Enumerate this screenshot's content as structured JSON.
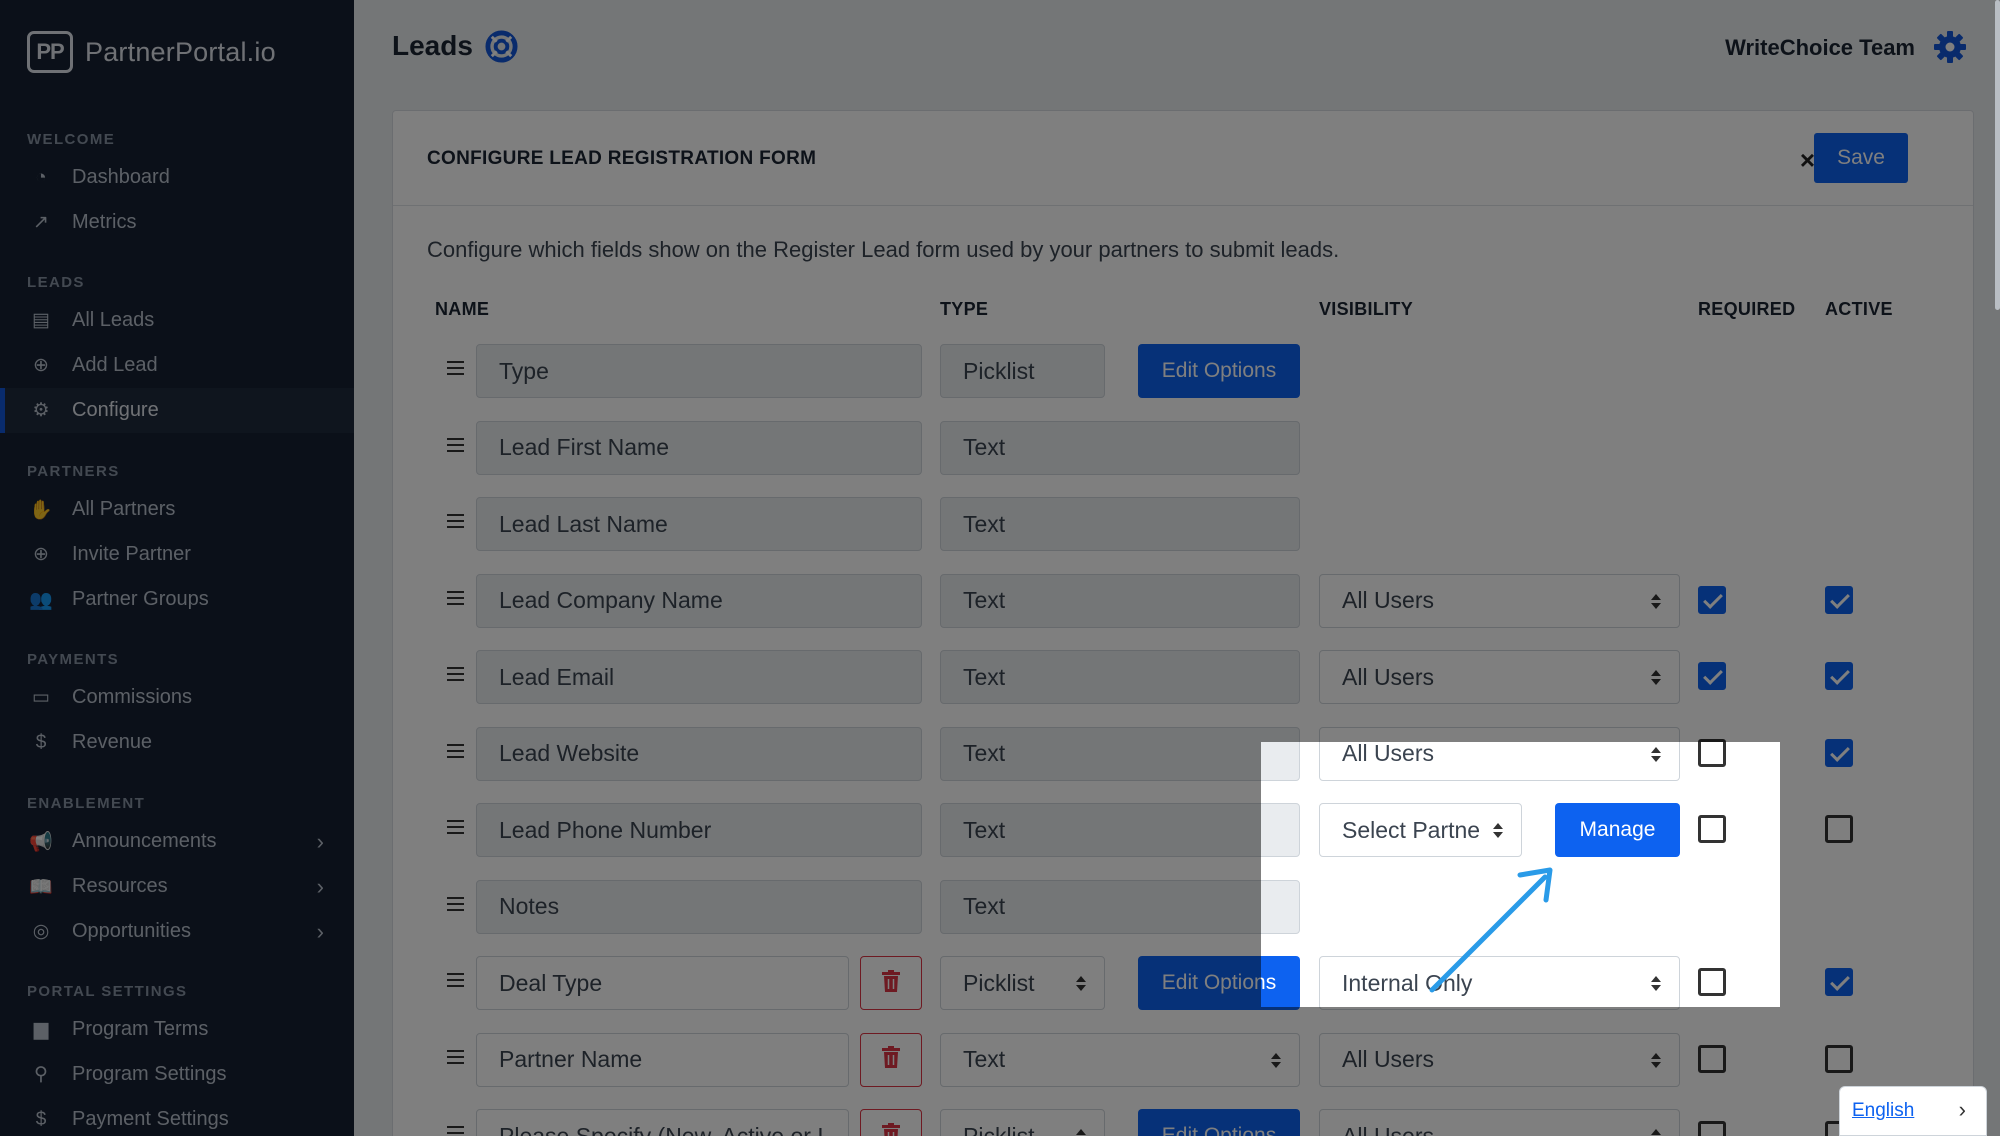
{
  "brand": {
    "logo": "PP",
    "name": "PartnerPortal.io"
  },
  "sidebar": {
    "sections": [
      {
        "title": "WELCOME",
        "items": [
          {
            "label": "Dashboard",
            "icon": "dashboard-icon",
            "glyph": "◔"
          },
          {
            "label": "Metrics",
            "icon": "chart-line-icon",
            "glyph": "↗"
          }
        ]
      },
      {
        "title": "LEADS",
        "items": [
          {
            "label": "All Leads",
            "icon": "clipboard-icon",
            "glyph": "▤"
          },
          {
            "label": "Add Lead",
            "icon": "plus-circle-icon",
            "glyph": "⊕"
          },
          {
            "label": "Configure",
            "icon": "gear-icon",
            "glyph": "⚙",
            "active": true
          }
        ]
      },
      {
        "title": "PARTNERS",
        "items": [
          {
            "label": "All Partners",
            "icon": "handshake-icon",
            "glyph": "✋"
          },
          {
            "label": "Invite Partner",
            "icon": "plus-circle-icon",
            "glyph": "⊕"
          },
          {
            "label": "Partner Groups",
            "icon": "users-icon",
            "glyph": "👥"
          }
        ]
      },
      {
        "title": "PAYMENTS",
        "items": [
          {
            "label": "Commissions",
            "icon": "credit-card-icon",
            "glyph": "▭"
          },
          {
            "label": "Revenue",
            "icon": "dollar-icon",
            "glyph": "$"
          }
        ]
      },
      {
        "title": "ENABLEMENT",
        "items": [
          {
            "label": "Announcements",
            "icon": "megaphone-icon",
            "glyph": "📢",
            "chevron": true
          },
          {
            "label": "Resources",
            "icon": "book-icon",
            "glyph": "📖",
            "chevron": true
          },
          {
            "label": "Opportunities",
            "icon": "bullseye-icon",
            "glyph": "◎",
            "chevron": true
          }
        ]
      },
      {
        "title": "PORTAL SETTINGS",
        "items": [
          {
            "label": "Program Terms",
            "icon": "file-icon",
            "glyph": "▆"
          },
          {
            "label": "Program Settings",
            "icon": "award-icon",
            "glyph": "⚲"
          },
          {
            "label": "Payment Settings",
            "icon": "dollar-icon",
            "glyph": "$"
          }
        ]
      }
    ]
  },
  "header": {
    "title": "Leads",
    "team": "WriteChoice Team"
  },
  "card": {
    "title": "CONFIGURE LEAD REGISTRATION FORM",
    "close": "×",
    "save": "Save",
    "description": "Configure which fields show on the Register Lead form used by your partners to submit leads.",
    "columns": {
      "name": "NAME",
      "type": "TYPE",
      "visibility": "VISIBILITY",
      "required": "REQUIRED",
      "active": "ACTIVE"
    }
  },
  "rows": [
    {
      "name": "Type",
      "type": "Picklist",
      "edit_options": "Edit Options"
    },
    {
      "name": "Lead First Name",
      "type": "Text"
    },
    {
      "name": "Lead Last Name",
      "type": "Text"
    },
    {
      "name": "Lead Company Name",
      "type": "Text",
      "visibility": "All Users",
      "required": true,
      "active": true
    },
    {
      "name": "Lead Email",
      "type": "Text",
      "visibility": "All Users",
      "required": true,
      "active": true
    },
    {
      "name": "Lead Website",
      "type": "Text",
      "visibility": "All Users",
      "required": false,
      "active": true
    },
    {
      "name": "Lead Phone Number",
      "type": "Text",
      "visibility": "Select Partne",
      "manage": "Manage",
      "required": false,
      "active": false
    },
    {
      "name": "Notes",
      "type": "Text"
    },
    {
      "name": "Deal Type",
      "type": "Picklist",
      "edit_options": "Edit Options",
      "visibility": "Internal Only",
      "required": false,
      "active": true,
      "custom": true
    },
    {
      "name": "Partner Name",
      "type": "Text",
      "visibility": "All Users",
      "required": false,
      "active": false,
      "custom": true
    },
    {
      "name": "Please Specify (New, Active or I",
      "type": "Picklist",
      "edit_options": "Edit Options",
      "visibility": "All Users",
      "required": false,
      "active": false,
      "custom": true
    }
  ],
  "language": {
    "label": "English"
  },
  "colors": {
    "primary": "#0d62f0",
    "sidebar": "#162132",
    "danger": "#dc3545",
    "annotation_arrow": "#2a9be8"
  }
}
